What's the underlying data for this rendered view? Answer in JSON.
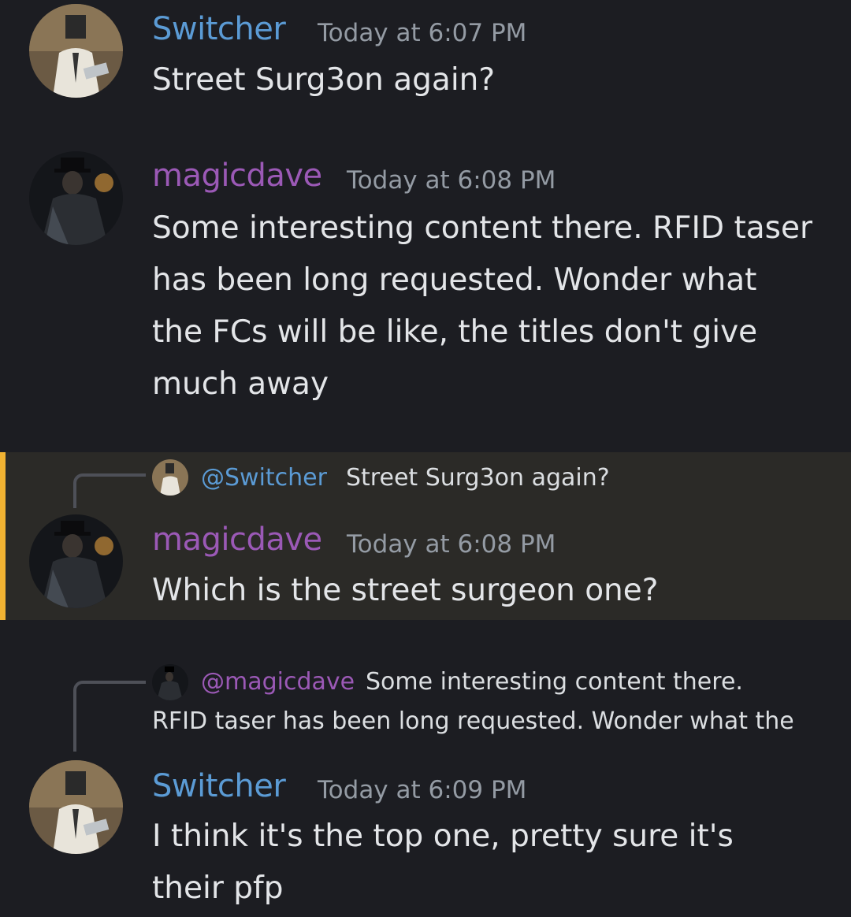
{
  "colors": {
    "background": "#1c1d22",
    "switcher_name": "#5b9bd5",
    "magicdave_name": "#9b59b6",
    "timestamp": "#949ba4",
    "mention_highlight_bg": "#2b2a27",
    "mention_bar": "#f0b232"
  },
  "messages": [
    {
      "author": "Switcher",
      "timestamp": "Today at 6:07 PM",
      "text": "Street Surg3on again?",
      "avatar_icon": "switcher-avatar"
    },
    {
      "author": "magicdave",
      "timestamp": "Today at 6:08 PM",
      "text": "Some interesting content there. RFID taser has been long requested. Wonder what the FCs will be like, the titles don't give much away",
      "avatar_icon": "magicdave-avatar"
    },
    {
      "reply": {
        "mention": "@Switcher",
        "text": "Street Surg3on again?"
      },
      "author": "magicdave",
      "timestamp": "Today at 6:08 PM",
      "text": "Which is the street surgeon one?",
      "avatar_icon": "magicdave-avatar"
    },
    {
      "reply": {
        "mention": "@magicdave",
        "text_line1": "Some interesting content there.",
        "text_line2": "RFID taser has been long requested. Wonder what the"
      },
      "author": "Switcher",
      "timestamp": "Today at 6:09 PM",
      "text": "I think it's the top one, pretty sure it's their pfp",
      "avatar_icon": "switcher-avatar"
    }
  ]
}
